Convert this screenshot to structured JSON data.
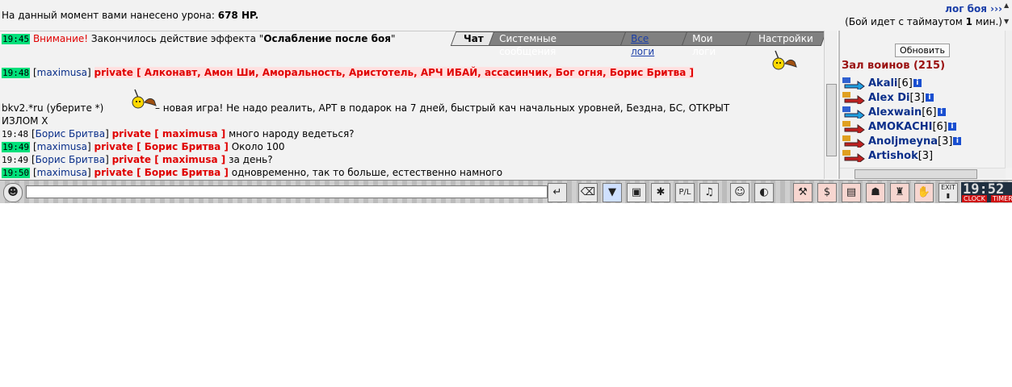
{
  "top": {
    "damage_text": "На данный момент вами нанесено урона:",
    "damage_value": "678 HP.",
    "battle_log_link": "лог боя ›››",
    "timeout_prefix": "(Бой идет с таймаутом",
    "timeout_value": "1",
    "timeout_suffix": "мин.)"
  },
  "tabs": [
    {
      "label": "Чат"
    },
    {
      "label": "Системные сообщения"
    },
    {
      "label": "Все логи"
    },
    {
      "label": "Мои логи"
    },
    {
      "label": "Настройки"
    }
  ],
  "chat": {
    "m1": {
      "time": "19:45",
      "warn": "Внимание!",
      "text": "Закончилось действие эффекта \"",
      "effect": "Ослабление после боя",
      "end": "\""
    },
    "m2": {
      "time": "19:48",
      "nick": "maximusa",
      "priv": "private [ Алконавт, Амон Ши, Аморальность, Аристотель, АРЧ ИБАЙ, ассасинчик, Бог огня, Борис Бритва ]"
    },
    "m3": {
      "line1_a": "bkv2.*ru (уберите *)",
      "line1_b": "– новая игра! Не надо реалить, АРТ в подарок на 7 дней, быстрый кач начальных уровней, Бездна, БС, ОТКРЫТ",
      "line2": "ИЗЛОМ Х"
    },
    "m4": {
      "time": "19:48",
      "nick": "Борис Бритва",
      "priv": "private [ maximusa ]",
      "text": "много народу ведеться?"
    },
    "m5": {
      "time": "19:49",
      "nick": "maximusa",
      "priv": "private [ Борис Бритва ]",
      "text": "Около 100"
    },
    "m6": {
      "time": "19:49",
      "nick": "Борис Бритва",
      "priv": "private [ maximusa ]",
      "text": "за день?"
    },
    "m7": {
      "time": "19:50",
      "nick": "maximusa",
      "priv": "private [ Борис Бритва ]",
      "text": "одновременно, так то больше, естественно намного"
    }
  },
  "right": {
    "refresh_label": "Обновить",
    "room_title": "Зал воинов (215)",
    "warriors": [
      {
        "name": "Akali",
        "level": "[6]"
      },
      {
        "name": "Alex Di",
        "level": "[3]"
      },
      {
        "name": "Alexwain",
        "level": "[6]"
      },
      {
        "name": "AMOKACHI",
        "level": "[6]"
      },
      {
        "name": "Anoljmeyna",
        "level": "[3]"
      },
      {
        "name": "Artishok",
        "level": "[3]"
      }
    ]
  },
  "bottom": {
    "clock_time": "19:52",
    "clock_label": "CLOCK",
    "timer_label": "TIMER",
    "exit_label": "EXIT"
  }
}
